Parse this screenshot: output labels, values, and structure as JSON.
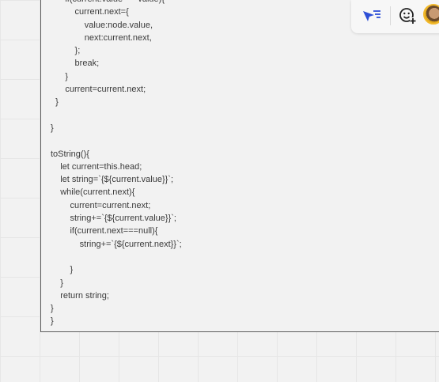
{
  "code_lines": [
    "      if(current.value===value){",
    "          current.next={",
    "              value:node.value,",
    "              next:current.next,",
    "          };",
    "          break;",
    "      }",
    "      current=current.next;",
    "  }",
    "",
    "}",
    "",
    "toString(){",
    "    let current=this.head;",
    "    let string=`{${current.value}}`;",
    "    while(current.next){",
    "        current=current.next;",
    "        string+=`{${current.value}}`;",
    "        if(current.next===null){",
    "            string+=`{${current.next}}`;",
    "",
    "        }",
    "    }",
    "    return string;",
    "}",
    "}"
  ],
  "toolbar": {
    "icons": [
      "cursor-filter-icon",
      "emoji-add-icon",
      "user-avatar"
    ],
    "accent_color": "#2d4fd6"
  }
}
